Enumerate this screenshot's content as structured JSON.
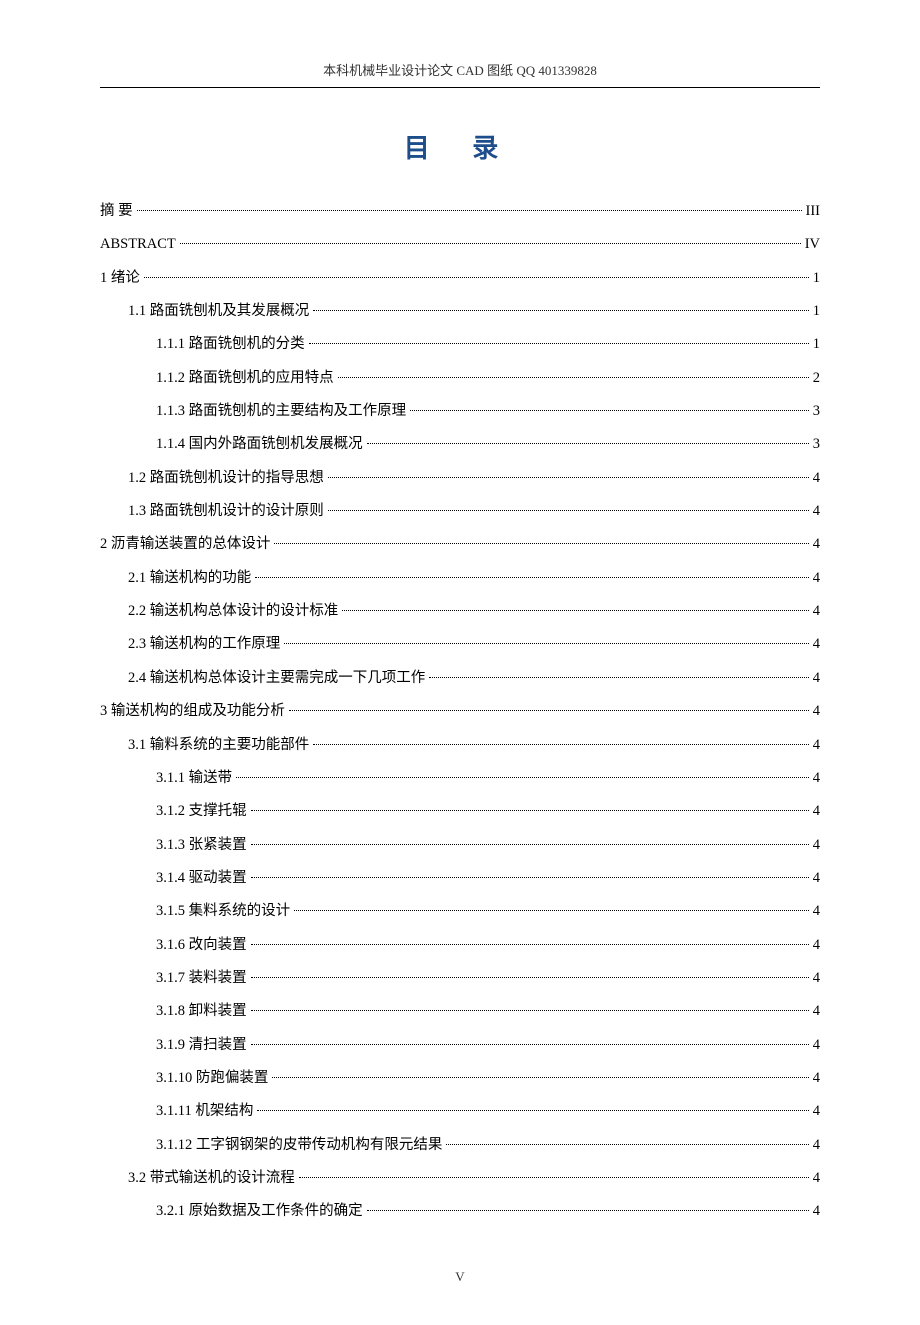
{
  "header": "本科机械毕业设计论文 CAD 图纸  QQ 401339828",
  "title": "目  录",
  "footer": "V",
  "toc": [
    {
      "level": 0,
      "label": "摘    要",
      "page": "III"
    },
    {
      "level": 0,
      "label": "ABSTRACT",
      "page": "IV"
    },
    {
      "level": 0,
      "label": "1 绪论",
      "page": "1"
    },
    {
      "level": 1,
      "label": "1.1 路面铣刨机及其发展概况",
      "page": "1"
    },
    {
      "level": 2,
      "label": "1.1.1 路面铣刨机的分类",
      "page": "1"
    },
    {
      "level": 2,
      "label": "1.1.2 路面铣刨机的应用特点",
      "page": "2"
    },
    {
      "level": 2,
      "label": "1.1.3 路面铣刨机的主要结构及工作原理",
      "page": "3"
    },
    {
      "level": 2,
      "label": "1.1.4 国内外路面铣刨机发展概况",
      "page": "3"
    },
    {
      "level": 1,
      "label": "1.2 路面铣刨机设计的指导思想",
      "page": "4"
    },
    {
      "level": 1,
      "label": "1.3 路面铣刨机设计的设计原则",
      "page": "4"
    },
    {
      "level": 0,
      "label": "2  沥青输送装置的总体设计",
      "page": "4"
    },
    {
      "level": 1,
      "label": "2.1 输送机构的功能",
      "page": "4"
    },
    {
      "level": 1,
      "label": "2.2 输送机构总体设计的设计标准",
      "page": "4"
    },
    {
      "level": 1,
      "label": "2.3 输送机构的工作原理",
      "page": "4"
    },
    {
      "level": 1,
      "label": "2.4 输送机构总体设计主要需完成一下几项工作",
      "page": "4"
    },
    {
      "level": 0,
      "label": "3  输送机构的组成及功能分析",
      "page": "4"
    },
    {
      "level": 1,
      "label": "3.1 输料系统的主要功能部件",
      "page": "4"
    },
    {
      "level": 2,
      "label": "3.1.1 输送带",
      "page": "4"
    },
    {
      "level": 2,
      "label": "3.1.2 支撑托辊",
      "page": "4"
    },
    {
      "level": 2,
      "label": "3.1.3 张紧装置",
      "page": "4"
    },
    {
      "level": 2,
      "label": "3.1.4   驱动装置",
      "page": "4"
    },
    {
      "level": 2,
      "label": "3.1.5 集料系统的设计",
      "page": "4"
    },
    {
      "level": 2,
      "label": "3.1.6 改向装置",
      "page": "4"
    },
    {
      "level": 2,
      "label": "3.1.7 装料装置",
      "page": "4"
    },
    {
      "level": 2,
      "label": "3.1.8 卸料装置",
      "page": "4"
    },
    {
      "level": 2,
      "label": "3.1.9 清扫装置",
      "page": "4"
    },
    {
      "level": 2,
      "label": "3.1.10 防跑偏装置",
      "page": "4"
    },
    {
      "level": 2,
      "label": "3.1.11 机架结构",
      "page": "4"
    },
    {
      "level": 2,
      "label": "3.1.12 工字钢钢架的皮带传动机构有限元结果",
      "page": "4"
    },
    {
      "level": 1,
      "label": "3.2 带式输送机的设计流程",
      "page": "4"
    },
    {
      "level": 2,
      "label": "3.2.1 原始数据及工作条件的确定",
      "page": "4"
    }
  ]
}
